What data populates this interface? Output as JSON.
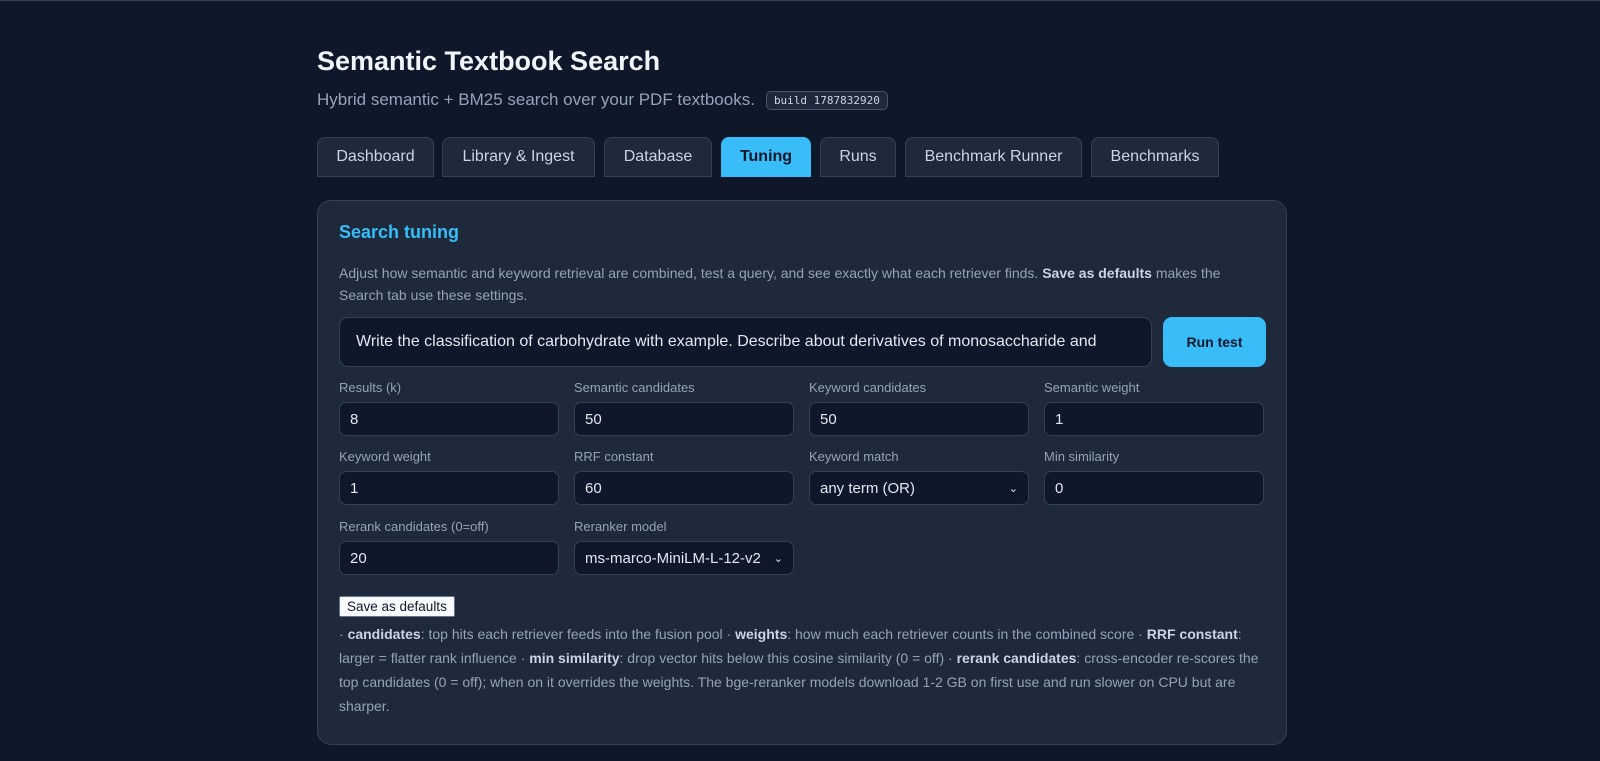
{
  "app": {
    "title": "Semantic Textbook Search",
    "subtitle": "Hybrid semantic + BM25 search over your PDF textbooks.",
    "build": "build 1787832920"
  },
  "tabs": [
    {
      "label": "Dashboard"
    },
    {
      "label": "Library & Ingest"
    },
    {
      "label": "Database"
    },
    {
      "label": "Tuning",
      "active": true
    },
    {
      "label": "Runs"
    },
    {
      "label": "Benchmark Runner"
    },
    {
      "label": "Benchmarks"
    }
  ],
  "tuning": {
    "heading": "Search tuning",
    "desc_pre": "Adjust how semantic and keyword retrieval are combined, test a query, and see exactly what each retriever finds. ",
    "desc_bold": "Save as defaults",
    "desc_post": " makes the Search tab use these settings.",
    "query_value": "Write the classification of carbohydrate with example. Describe about derivatives of monosaccharide and",
    "run_label": "Run test",
    "fields": {
      "results_k": {
        "label": "Results (k)",
        "value": "8"
      },
      "semantic_candidates": {
        "label": "Semantic candidates",
        "value": "50"
      },
      "keyword_candidates": {
        "label": "Keyword candidates",
        "value": "50"
      },
      "semantic_weight": {
        "label": "Semantic weight",
        "value": "1"
      },
      "keyword_weight": {
        "label": "Keyword weight",
        "value": "1"
      },
      "rrf_constant": {
        "label": "RRF constant",
        "value": "60"
      },
      "keyword_match": {
        "label": "Keyword match",
        "value": "any term (OR)"
      },
      "min_similarity": {
        "label": "Min similarity",
        "value": "0"
      },
      "rerank_candidates": {
        "label": "Rerank candidates (0=off)",
        "value": "20"
      },
      "reranker_model": {
        "label": "Reranker model",
        "value": "ms-marco-MiniLM-L-12-v2"
      }
    },
    "save_label": "Save as defaults",
    "help": {
      "p1": "· ",
      "b1": "candidates",
      "t1": ": top hits each retriever feeds into the fusion pool  · ",
      "b2": "weights",
      "t2": ": how much each retriever counts in the combined score  · ",
      "b3": "RRF constant",
      "t3": ": larger = flatter rank influence  · ",
      "b4": "min similarity",
      "t4": ": drop vector hits below this cosine similarity (0 = off)  · ",
      "b5": "rerank candidates",
      "t5": ": cross-encoder re-scores the top candidates (0 = off); when on it overrides the weights. The bge-reranker models download 1-2 GB on first use and run slower on CPU but are sharper."
    }
  }
}
